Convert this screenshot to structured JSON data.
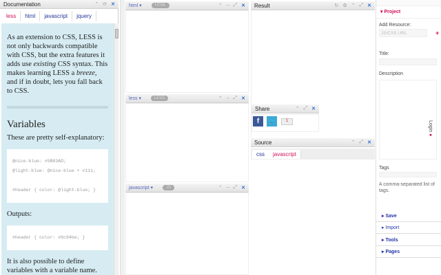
{
  "documentation": {
    "title": "Documentation",
    "tabs": [
      "less",
      "html",
      "javascript",
      "jquery"
    ],
    "intro": "As an extension to CSS, LESS is not only backwards compatible with CSS, but the extra features it adds use existing CSS syntax. This makes learning LESS a breeze, and if in doubt, lets you fall back to CSS.",
    "intro_pre": "As an extension to CSS, LESS is not only backwards compatible with CSS, but the extra features it adds use ",
    "intro_em1": "existing",
    "intro_mid": " CSS syntax. This makes learning LESS a ",
    "intro_em2": "breeze",
    "intro_post": ", and if in doubt, lets you fall back to CSS.",
    "heading": "Variables",
    "p1": "These are pretty self-explanatory:",
    "code1": [
      "@nice-blue: #5B83AD;",
      "@light-blue: @nice-blue + #111;",
      "",
      "#header { color: @light-blue; }"
    ],
    "p2": "Outputs:",
    "code2": "#header { color: #6c94be; }",
    "p3": "It is also possible to define variables with a variable name."
  },
  "editors": [
    {
      "mode": "html",
      "badge": "HTML"
    },
    {
      "mode": "less",
      "badge": "LESS"
    },
    {
      "mode": "javascript",
      "badge": "JS"
    }
  ],
  "result": {
    "title": "Result"
  },
  "share": {
    "title": "Share",
    "facebook": "f",
    "count": "1"
  },
  "source": {
    "title": "Source",
    "tabs": [
      "css",
      "javascript"
    ]
  },
  "sidebar": {
    "project": "Project",
    "add_resource": "Add Resource:",
    "resource_placeholder": "JS/CSS URL",
    "title": "Title:",
    "description": "Description",
    "login": "Login",
    "tags": "Tags",
    "tags_hint": "A comma-separated list of tags.",
    "sections": [
      "Save",
      "Import",
      "Tools",
      "Pages"
    ]
  }
}
